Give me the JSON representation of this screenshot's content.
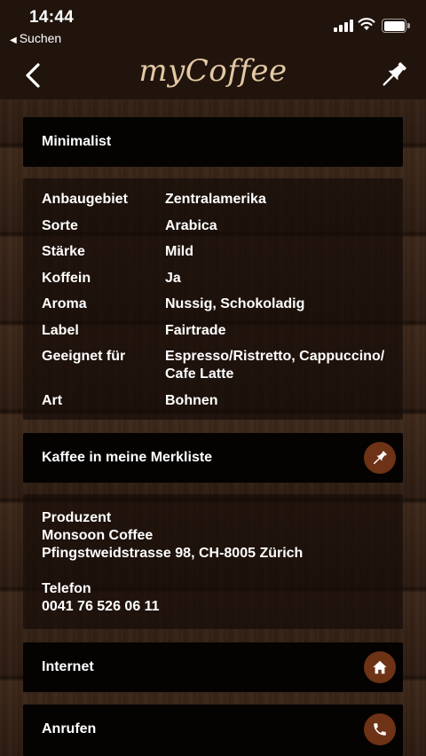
{
  "status_bar": {
    "time": "14:44",
    "back_app": "Suchen",
    "icons": [
      "cellular-signal-icon",
      "wifi-icon",
      "battery-icon"
    ]
  },
  "nav": {
    "logo": "myCoffee",
    "back_icon": "chevron-left-icon",
    "pin_icon": "pushpin-icon"
  },
  "product": {
    "name": "Minimalist"
  },
  "attributes": [
    {
      "label": "Anbaugebiet",
      "value": "Zentralamerika"
    },
    {
      "label": "Sorte",
      "value": "Arabica"
    },
    {
      "label": "Stärke",
      "value": "Mild"
    },
    {
      "label": "Koffein",
      "value": "Ja"
    },
    {
      "label": "Aroma",
      "value": "Nussig, Schokoladig"
    },
    {
      "label": "Label",
      "value": "Fairtrade"
    },
    {
      "label": "Geeignet für",
      "value": "Espresso/Ristretto, Cappuccino/ Cafe Latte"
    },
    {
      "label": "Art",
      "value": "Bohnen"
    }
  ],
  "merkliste": {
    "label": "Kaffee in meine Merkliste",
    "icon": "pushpin-icon"
  },
  "producer": {
    "heading": "Produzent",
    "name": "Monsoon Coffee",
    "address": "Pfingstweidstrasse 98, CH-8005 Zürich",
    "phone_heading": "Telefon",
    "phone": "0041 76 526 06 11"
  },
  "actions": {
    "internet": {
      "label": "Internet",
      "icon": "home-icon"
    },
    "call": {
      "label": "Anrufen",
      "icon": "phone-icon"
    }
  },
  "colors": {
    "accent": "#6e3216",
    "logo": "#e3c9a4",
    "bar": "#21140d",
    "card": "#050302"
  }
}
